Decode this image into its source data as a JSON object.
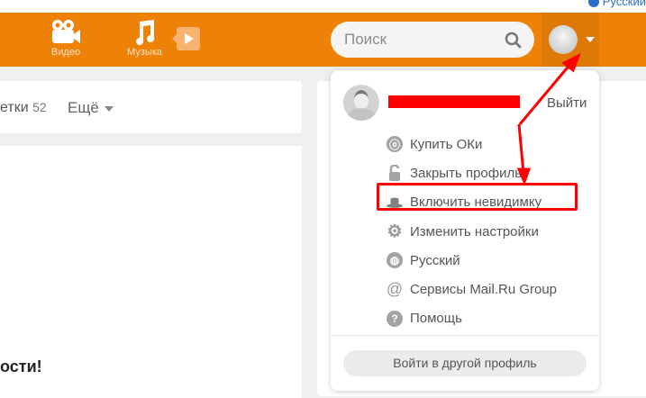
{
  "top_bar": {
    "language": "Русский"
  },
  "header": {
    "nav": [
      {
        "label": "Видео",
        "icon": "video-camera-icon"
      },
      {
        "label": "Музыка",
        "icon": "music-note-icon"
      }
    ],
    "search": {
      "placeholder": "Поиск"
    }
  },
  "feed": {
    "tab_partial": "етки",
    "tab_count": "52",
    "more_label": "Ещё",
    "post_title_partial": "ости!"
  },
  "dropdown": {
    "logout": "Выйти",
    "items": [
      {
        "label": "Купить ОКи",
        "icon": "ok-coin-icon"
      },
      {
        "label": "Закрыть профиль",
        "icon": "lock-icon"
      },
      {
        "label": "Включить невидимку",
        "icon": "hat-icon"
      },
      {
        "label": "Изменить настройки",
        "icon": "gear-icon"
      },
      {
        "label": "Русский",
        "icon": "globe-icon"
      },
      {
        "label": "Сервисы Mail.Ru Group",
        "icon": "at-icon"
      },
      {
        "label": "Помощь",
        "icon": "help-icon"
      }
    ],
    "other_profile": "Войти в другой профиль"
  },
  "colors": {
    "brand": "#ee8208",
    "annotation": "#ff0000"
  }
}
